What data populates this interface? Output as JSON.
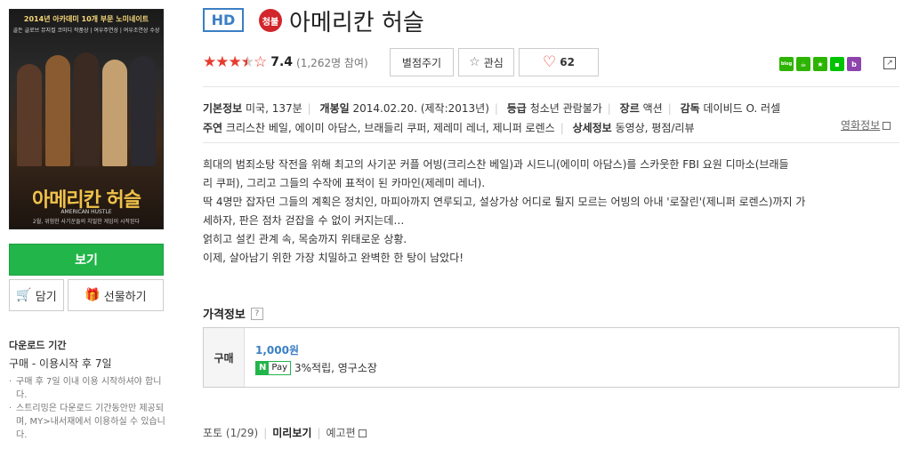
{
  "poster": {
    "top_text": "2014년 아카데미 10개 부문 노미네이트",
    "top_text2": "골든 글로브 뮤지컬 코미디 작품상 | 여우주연상 | 여우조연상 수상",
    "title": "아메리칸 허슬",
    "subtitle": "AMERICAN HUSTLE",
    "bottom_text": "2월, 위험한 사기꾼들의 치밀한 게임이 시작된다"
  },
  "actions": {
    "watch": "보기",
    "cart": "담기",
    "gift": "선물하기"
  },
  "download": {
    "heading": "다운로드 기간",
    "line": "구매 - 이용시작 후 7일",
    "notes": [
      "구매 후 7일 이내 이용 시작하셔야 합니다.",
      "스트리밍은 다운로드 기간동안만 제공되며, MY>내서재에서 이용하실 수 있습니다."
    ]
  },
  "header": {
    "hd_badge": "HD",
    "age_badge": "청불",
    "title": "아메리칸 허슬"
  },
  "rating": {
    "score": "7.4",
    "votes": "(1,262명 참여)",
    "rate_button": "별점주기",
    "interest_button": "관심",
    "like_count": "62",
    "stars_filled": 3.5
  },
  "share_icons": [
    "blog",
    "cafe",
    "me",
    "line",
    "band"
  ],
  "info": {
    "basic_label": "기본정보",
    "basic_value": "미국, 137분",
    "release_label": "개봉일",
    "release_value": "2014.02.20. (제작:2013년)",
    "grade_label": "등급",
    "grade_value": "청소년 관람불가",
    "genre_label": "장르",
    "genre_value": "액션",
    "director_label": "감독",
    "director_value": "데이비드 O. 러셀",
    "cast_label": "주연",
    "cast_value": "크리스찬 베일, 에이미 아담스, 브래들리 쿠퍼, 제레미 레너, 제니퍼 로렌스",
    "detail_label": "상세정보",
    "detail_value": "동영상, 평점/리뷰",
    "movie_info_link": "영화정보"
  },
  "synopsis": [
    "희대의 범죄소탕 작전을 위해 최고의 사기꾼 커플 어빙(크리스찬 베일)과 시드니(에이미 아담스)를 스카웃한 FBI 요원 디마소(브래들",
    "리 쿠퍼), 그리고 그들의 수작에 표적이 된 카마인(제레미 레너).",
    "딱 4명만 잡자던 그들의 계획은 정치인, 마피아까지 연루되고, 설상가상 어디로 튈지 모르는 어빙의 아내 '로잘린'(제니퍼 로렌스)까지 가",
    "세하자, 판은 점차 걷잡을 수 없이 커지는데…",
    "얽히고 설킨 관계 속, 목숨까지 위태로운 상황.",
    "이제, 살아남기 위한 가장 치밀하고 완벽한 한 탕이 남았다!"
  ],
  "price": {
    "section_title": "가격정보",
    "help": "?",
    "label": "구매",
    "value": "1,000원",
    "npay_n": "N",
    "npay_pay": "Pay",
    "npay_text": "3%적립, 영구소장"
  },
  "tabs": {
    "photo": "포토 (1/29)",
    "preview": "미리보기",
    "trailer": "예고편"
  }
}
